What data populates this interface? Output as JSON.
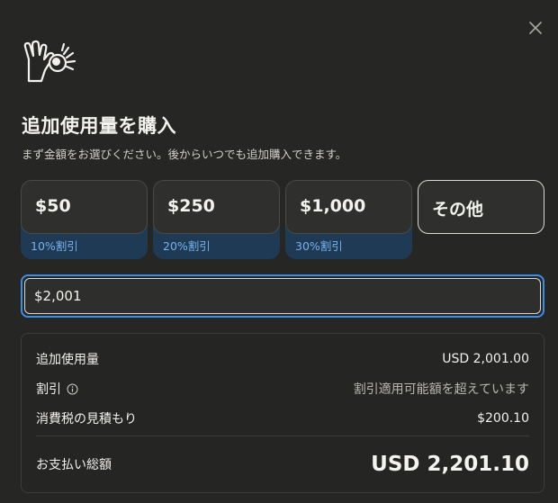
{
  "dialog": {
    "close_icon": "close-icon",
    "logo_icon": "claude-hand-logo-icon",
    "title": "追加使用量を購入",
    "subtitle": "まず金額をお選びください。後からいつでも追加購入できます。"
  },
  "options": [
    {
      "amount": "$50",
      "discount": "10%割引"
    },
    {
      "amount": "$250",
      "discount": "20%割引"
    },
    {
      "amount": "$1,000",
      "discount": "30%割引"
    },
    {
      "amount": "その他",
      "discount": ""
    }
  ],
  "custom": {
    "value": "$2,001",
    "placeholder": ""
  },
  "summary": {
    "usage_label": "追加使用量",
    "usage_value": "USD 2,001.00",
    "discount_label": "割引",
    "discount_info_icon": "info-icon",
    "discount_value": "割引適用可能額を超えています",
    "tax_label": "消費税の見積もり",
    "tax_value": "$200.10",
    "total_label": "お支払い総額",
    "total_value": "USD 2,201.10"
  },
  "colors": {
    "background": "#262624",
    "accent_blue": "#3b8ee8",
    "discount_text": "#78b2ec",
    "discount_band": "#1f3a55"
  }
}
